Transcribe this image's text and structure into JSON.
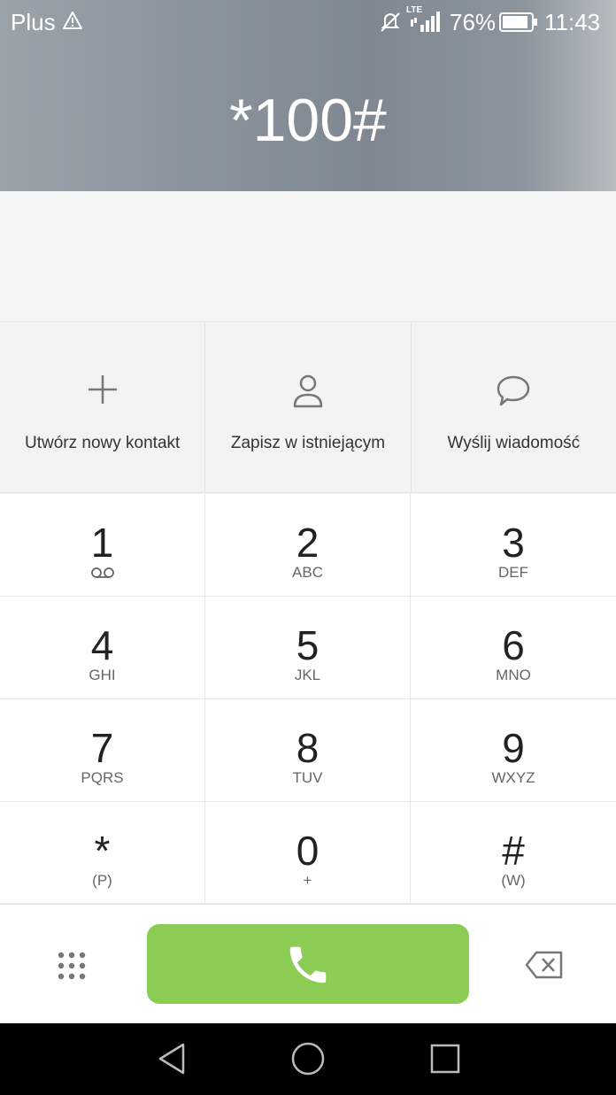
{
  "status_bar": {
    "carrier": "Plus",
    "network": "LTE",
    "battery": "76%",
    "time": "11:43",
    "icons": [
      "warning-icon",
      "mute-icon",
      "signal-icon",
      "battery-icon"
    ]
  },
  "dialer": {
    "number": "*100#"
  },
  "actions": [
    {
      "label": "Utwórz nowy kontakt",
      "icon": "plus-icon"
    },
    {
      "label": "Zapisz w istniejącym",
      "icon": "person-icon"
    },
    {
      "label": "Wyślij wiadomość",
      "icon": "chat-bubble-icon"
    }
  ],
  "keypad": {
    "keys": [
      {
        "digit": "1",
        "letters": "",
        "icon": "voicemail-icon"
      },
      {
        "digit": "2",
        "letters": "ABC"
      },
      {
        "digit": "3",
        "letters": "DEF"
      },
      {
        "digit": "4",
        "letters": "GHI"
      },
      {
        "digit": "5",
        "letters": "JKL"
      },
      {
        "digit": "6",
        "letters": "MNO"
      },
      {
        "digit": "7",
        "letters": "PQRS"
      },
      {
        "digit": "8",
        "letters": "TUV"
      },
      {
        "digit": "9",
        "letters": "WXYZ"
      },
      {
        "digit": "*",
        "letters": "(P)"
      },
      {
        "digit": "0",
        "letters": "+"
      },
      {
        "digit": "#",
        "letters": "(W)"
      }
    ]
  },
  "bottom_bar": {
    "call_color": "#8bcc55",
    "icons": [
      "dialpad-icon",
      "phone-icon",
      "backspace-icon"
    ]
  },
  "nav_bar": {
    "icons": [
      "back-icon",
      "home-icon",
      "recents-icon"
    ]
  }
}
